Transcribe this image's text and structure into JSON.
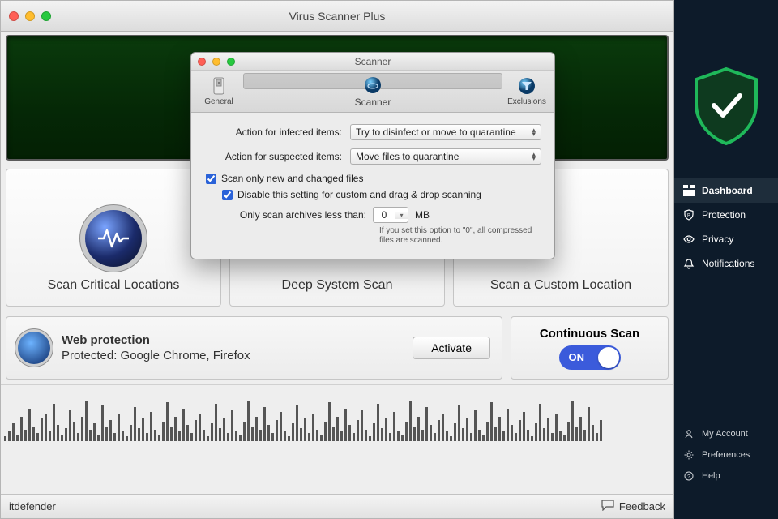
{
  "main_window": {
    "title": "Virus Scanner Plus",
    "scan_cards": [
      {
        "label": "Scan Critical Locations"
      },
      {
        "label": "Deep System Scan"
      },
      {
        "label": "Scan a Custom Location"
      }
    ],
    "web_protection": {
      "title": "Web protection",
      "status": "Protected: Google Chrome, Firefox",
      "activate_label": "Activate"
    },
    "continuous_scan": {
      "title": "Continuous Scan",
      "state_label": "ON"
    },
    "footer": {
      "brand_partial": "itdefender",
      "feedback_label": "Feedback"
    }
  },
  "scanner_modal": {
    "title": "Scanner",
    "tabs": [
      {
        "label": "General"
      },
      {
        "label": "Scanner"
      },
      {
        "label": "Exclusions"
      }
    ],
    "rows": {
      "infected_label": "Action for infected items:",
      "infected_value": "Try to disinfect or move to quarantine",
      "suspected_label": "Action for suspected items:",
      "suspected_value": "Move files to quarantine"
    },
    "check1": "Scan only new and changed files",
    "check2": "Disable this setting for custom and drag & drop scanning",
    "archives_label": "Only scan archives less than:",
    "archives_value": "0",
    "archives_unit": "MB",
    "archives_hint": "If you set this option to \"0\", all compressed files are scanned."
  },
  "sidebar": {
    "nav": [
      {
        "label": "Dashboard"
      },
      {
        "label": "Protection"
      },
      {
        "label": "Privacy"
      },
      {
        "label": "Notifications"
      }
    ],
    "bottom": [
      {
        "label": "My Account"
      },
      {
        "label": "Preferences"
      },
      {
        "label": "Help"
      }
    ]
  }
}
